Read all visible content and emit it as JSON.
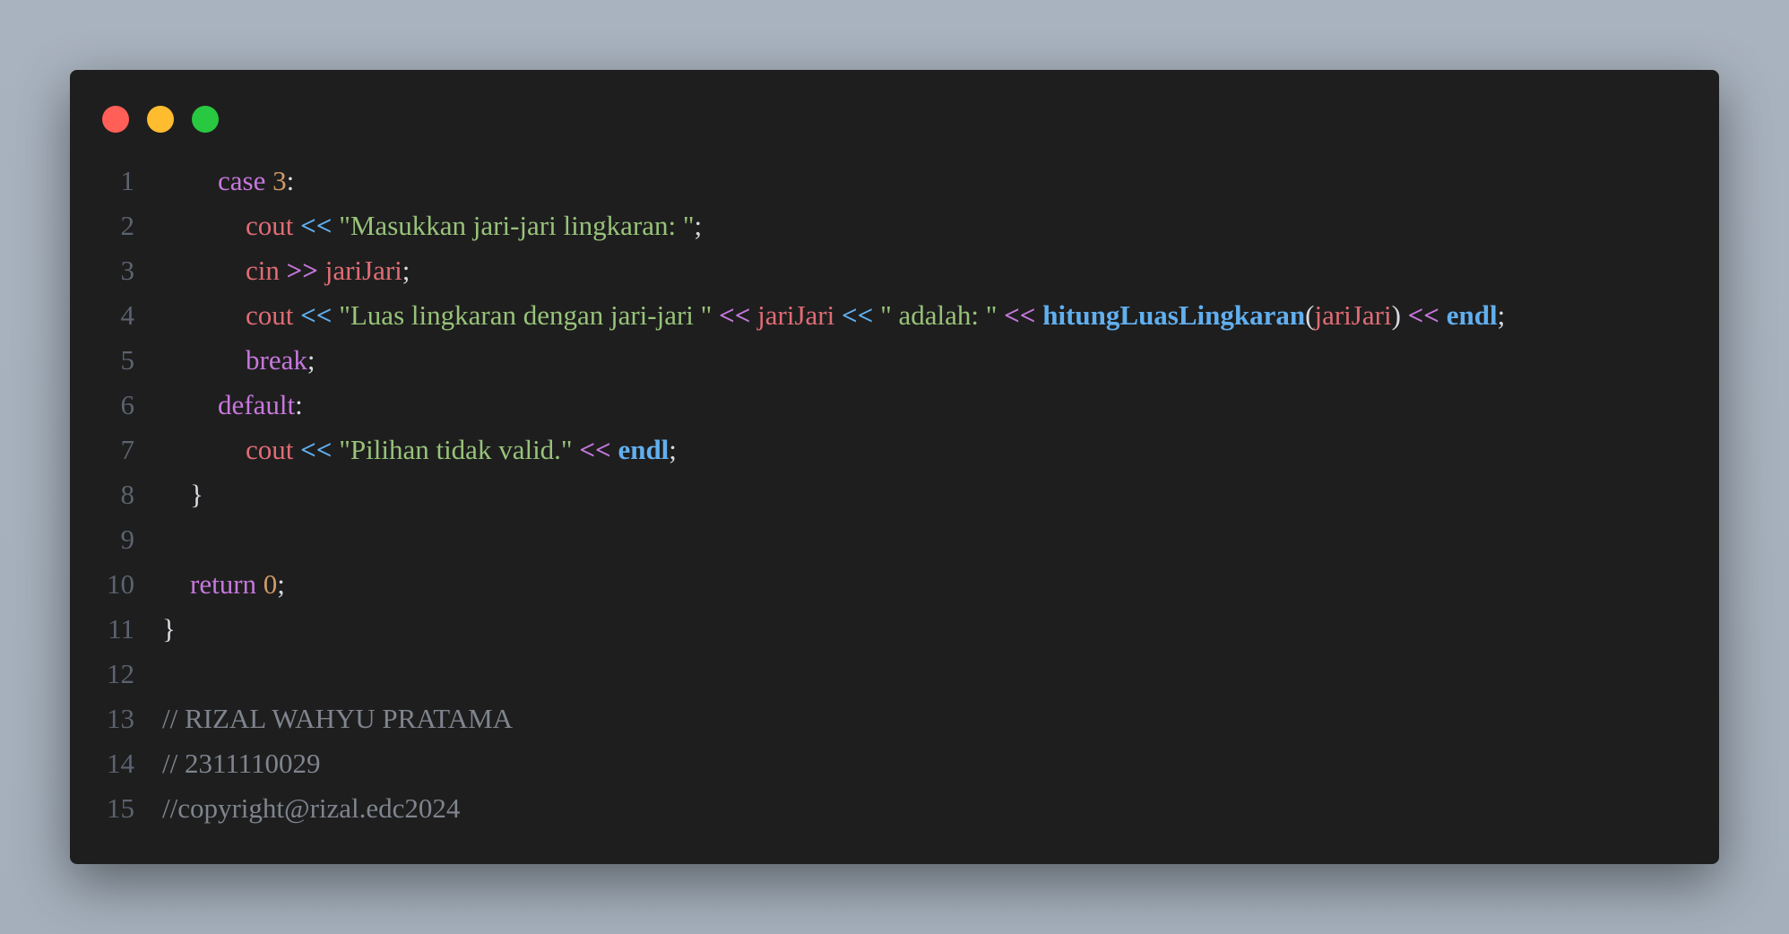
{
  "window_controls": {
    "close": "close",
    "minimize": "minimize",
    "maximize": "maximize"
  },
  "colors": {
    "background": "#a9b3bf",
    "editor": "#1e1e1e",
    "keyword": "#c678dd",
    "number": "#d19a66",
    "variable": "#e06c75",
    "string": "#98c379",
    "function": "#61afef",
    "comment": "#7f848e",
    "line_number": "#5c6370"
  },
  "lines": [
    {
      "number": "1",
      "indent": "        ",
      "tokens": [
        [
          "case",
          "kw"
        ],
        [
          " ",
          "pun"
        ],
        [
          "3",
          "num"
        ],
        [
          ":",
          "pun"
        ]
      ]
    },
    {
      "number": "2",
      "indent": "            ",
      "tokens": [
        [
          "cout",
          "var"
        ],
        [
          " ",
          "pun"
        ],
        [
          "<<",
          "op-b"
        ],
        [
          " ",
          "pun"
        ],
        [
          "\"Masukkan jari-jari lingkaran: \"",
          "str"
        ],
        [
          ";",
          "pun"
        ]
      ]
    },
    {
      "number": "3",
      "indent": "            ",
      "tokens": [
        [
          "cin",
          "var"
        ],
        [
          " ",
          "pun"
        ],
        [
          ">>",
          "op-p"
        ],
        [
          " ",
          "pun"
        ],
        [
          "jariJari",
          "var"
        ],
        [
          ";",
          "pun"
        ]
      ]
    },
    {
      "number": "4",
      "indent": "            ",
      "tokens": [
        [
          "cout",
          "var"
        ],
        [
          " ",
          "pun"
        ],
        [
          "<<",
          "op-b"
        ],
        [
          " ",
          "pun"
        ],
        [
          "\"Luas lingkaran dengan jari-jari \"",
          "str"
        ],
        [
          " ",
          "pun"
        ],
        [
          "<<",
          "op-p"
        ],
        [
          " ",
          "pun"
        ],
        [
          "jariJari",
          "var"
        ],
        [
          " ",
          "pun"
        ],
        [
          "<<",
          "op-b"
        ],
        [
          " ",
          "pun"
        ],
        [
          "\" adalah: \"",
          "str"
        ],
        [
          " ",
          "pun"
        ],
        [
          "<<",
          "op-p"
        ],
        [
          " ",
          "pun"
        ],
        [
          "hitungLuasLingkaran",
          "fn"
        ],
        [
          "(",
          "pun"
        ],
        [
          "jariJari",
          "var"
        ],
        [
          ")",
          "pun"
        ],
        [
          " ",
          "pun"
        ],
        [
          "<<",
          "op-p"
        ],
        [
          " ",
          "pun"
        ],
        [
          "endl",
          "fn"
        ],
        [
          ";",
          "pun"
        ]
      ]
    },
    {
      "number": "5",
      "indent": "            ",
      "tokens": [
        [
          "break",
          "kw"
        ],
        [
          ";",
          "pun"
        ]
      ]
    },
    {
      "number": "6",
      "indent": "        ",
      "tokens": [
        [
          "default",
          "kw"
        ],
        [
          ":",
          "pun"
        ]
      ]
    },
    {
      "number": "7",
      "indent": "            ",
      "tokens": [
        [
          "cout",
          "var"
        ],
        [
          " ",
          "pun"
        ],
        [
          "<<",
          "op-b"
        ],
        [
          " ",
          "pun"
        ],
        [
          "\"Pilihan tidak valid.\"",
          "str"
        ],
        [
          " ",
          "pun"
        ],
        [
          "<<",
          "op-p"
        ],
        [
          " ",
          "pun"
        ],
        [
          "endl",
          "fn"
        ],
        [
          ";",
          "pun"
        ]
      ]
    },
    {
      "number": "8",
      "indent": "    ",
      "tokens": [
        [
          "}",
          "pun"
        ]
      ]
    },
    {
      "number": "9",
      "indent": "",
      "tokens": []
    },
    {
      "number": "10",
      "indent": "    ",
      "tokens": [
        [
          "return",
          "kw"
        ],
        [
          " ",
          "pun"
        ],
        [
          "0",
          "num"
        ],
        [
          ";",
          "pun"
        ]
      ]
    },
    {
      "number": "11",
      "indent": "",
      "tokens": [
        [
          "}",
          "pun"
        ]
      ]
    },
    {
      "number": "12",
      "indent": "",
      "tokens": []
    },
    {
      "number": "13",
      "indent": "",
      "tokens": [
        [
          "// RIZAL WAHYU PRATAMA",
          "cm"
        ]
      ]
    },
    {
      "number": "14",
      "indent": "",
      "tokens": [
        [
          "// 2311110029",
          "cm"
        ]
      ]
    },
    {
      "number": "15",
      "indent": "",
      "tokens": [
        [
          "//copyright@rizal.edc2024",
          "cm"
        ]
      ]
    }
  ]
}
